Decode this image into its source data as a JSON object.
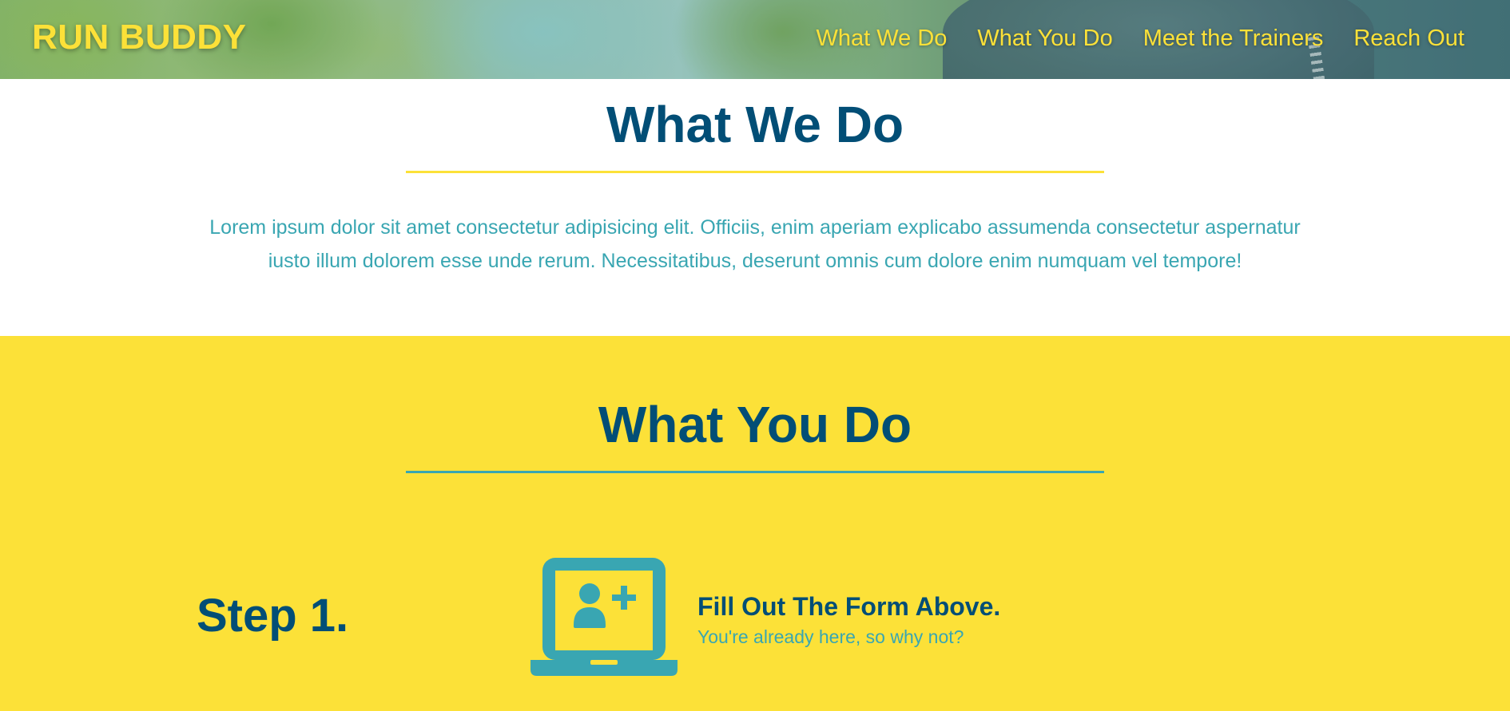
{
  "header": {
    "logo": "RUN BUDDY",
    "nav": [
      {
        "label": "What We Do"
      },
      {
        "label": "What You Do"
      },
      {
        "label": "Meet the Trainers"
      },
      {
        "label": "Reach Out"
      }
    ]
  },
  "what_we_do": {
    "title": "What We Do",
    "body": "Lorem ipsum dolor sit amet consectetur adipisicing elit. Officiis, enim aperiam explicabo assumenda consectetur aspernatur iusto illum dolorem esse unde rerum. Necessitatibus, deserunt omnis cum dolore enim numquam vel tempore!"
  },
  "what_you_do": {
    "title": "What You Do",
    "steps": [
      {
        "label": "Step 1.",
        "icon": "laptop-add-user-icon",
        "heading": "Fill Out The Form Above.",
        "subtext": "You're already here, so why not?"
      }
    ]
  },
  "colors": {
    "accent_yellow": "#fce138",
    "brand_navy": "#024e76",
    "brand_teal": "#39a6b2"
  }
}
